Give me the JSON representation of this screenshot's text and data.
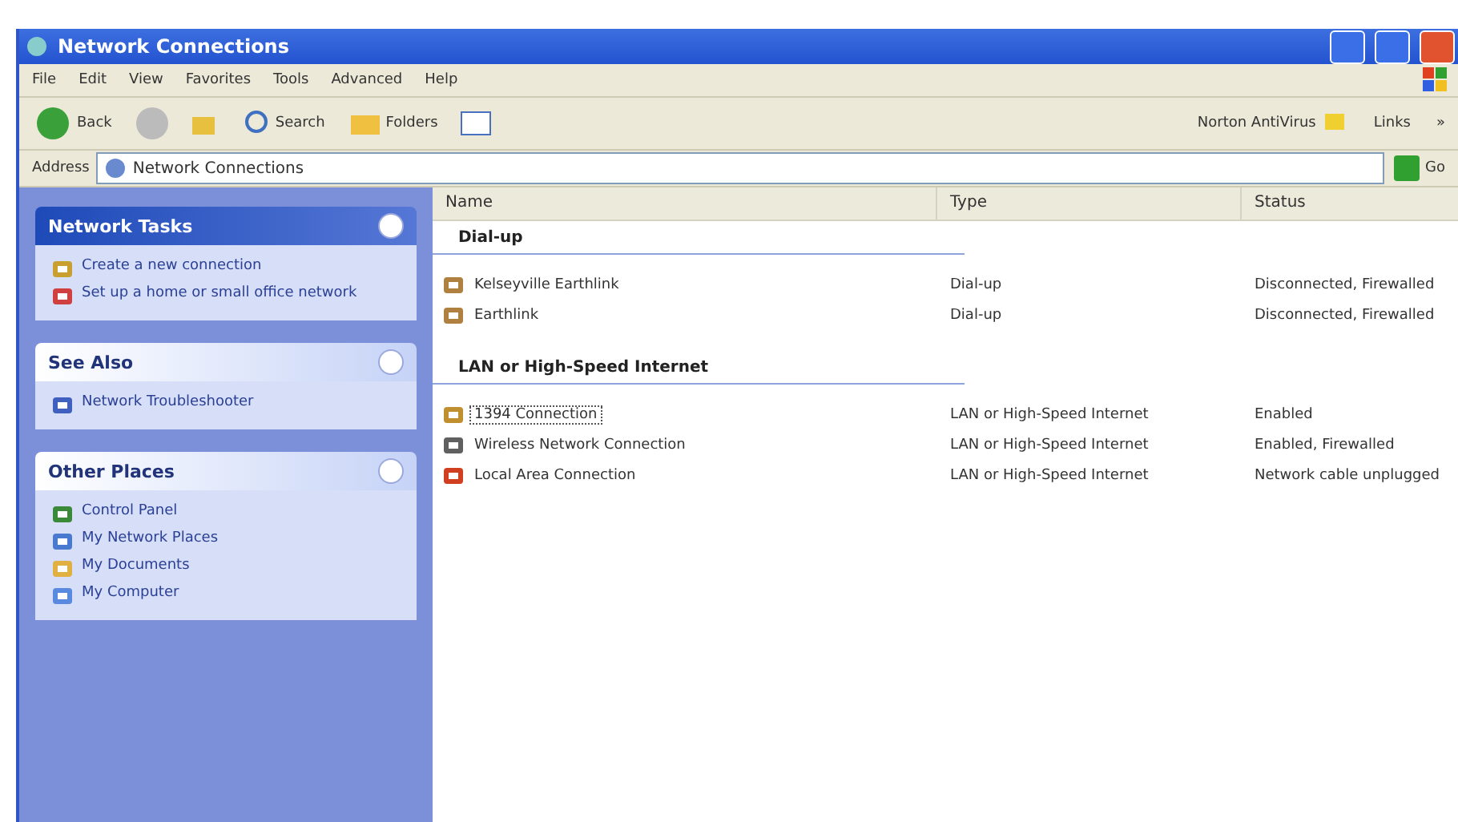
{
  "window": {
    "title": "Network Connections"
  },
  "menu": [
    "File",
    "Edit",
    "View",
    "Favorites",
    "Tools",
    "Advanced",
    "Help"
  ],
  "toolbar": {
    "back": "Back",
    "search": "Search",
    "folders": "Folders",
    "norton": "Norton AntiVirus",
    "links": "Links",
    "chevron": "»"
  },
  "address": {
    "label": "Address",
    "value": "Network Connections",
    "go": "Go"
  },
  "sidebar": [
    {
      "title": "Network Tasks",
      "kind": "special",
      "items": [
        {
          "label": "Create a new connection"
        },
        {
          "label": "Set up a home or small office network"
        }
      ]
    },
    {
      "title": "See Also",
      "kind": "normal",
      "items": [
        {
          "label": "Network Troubleshooter"
        }
      ]
    },
    {
      "title": "Other Places",
      "kind": "normal",
      "items": [
        {
          "label": "Control Panel"
        },
        {
          "label": "My Network Places"
        },
        {
          "label": "My Documents"
        },
        {
          "label": "My Computer"
        }
      ]
    }
  ],
  "table": {
    "columns": [
      "Name",
      "Type",
      "Status"
    ],
    "groups": [
      {
        "title": "Dial-up",
        "rows": [
          {
            "name": "Kelseyville Earthlink",
            "type": "Dial-up",
            "status": "Disconnected, Firewalled",
            "selected": false
          },
          {
            "name": "Earthlink",
            "type": "Dial-up",
            "status": "Disconnected, Firewalled",
            "selected": false
          }
        ]
      },
      {
        "title": "LAN or High-Speed Internet",
        "rows": [
          {
            "name": "1394 Connection",
            "type": "LAN or High-Speed Internet",
            "status": "Enabled",
            "selected": true
          },
          {
            "name": "Wireless Network Connection",
            "type": "LAN or High-Speed Internet",
            "status": "Enabled, Firewalled",
            "selected": false
          },
          {
            "name": "Local Area Connection",
            "type": "LAN or High-Speed Internet",
            "status": "Network cable unplugged",
            "selected": false
          }
        ]
      }
    ]
  }
}
